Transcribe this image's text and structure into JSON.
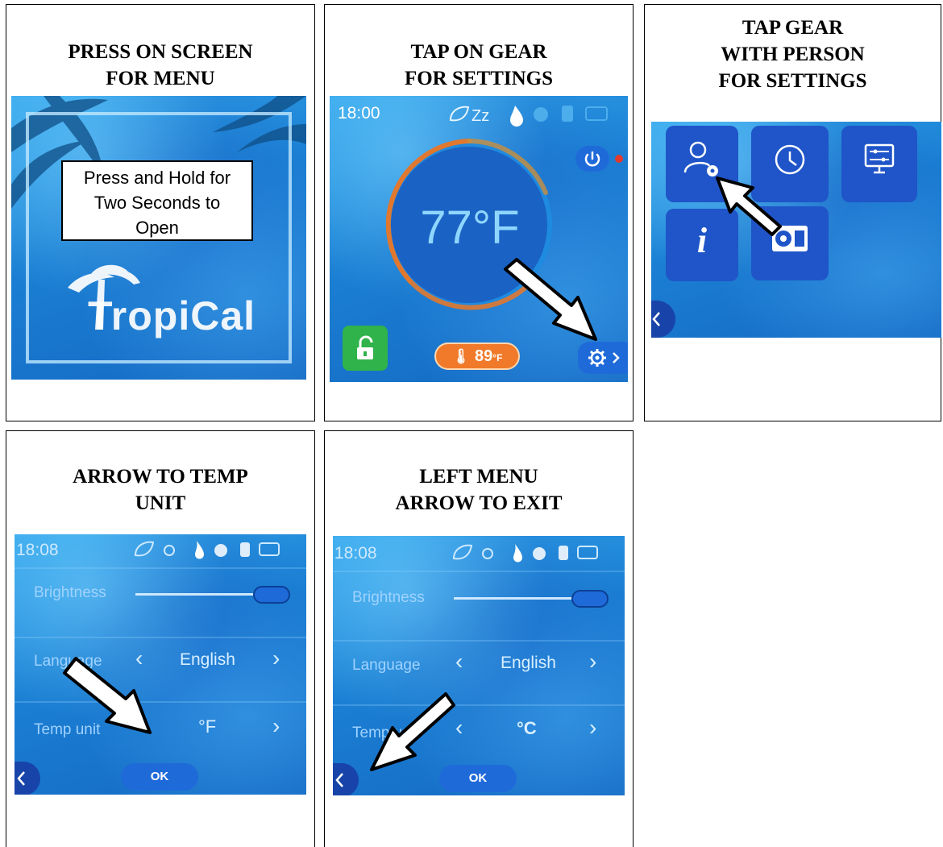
{
  "panels": [
    {
      "caption": [
        "PRESS ON SCREEN",
        "FOR MENU"
      ],
      "screen": {
        "callout_lines": [
          "Press and Hold for",
          "Two Seconds to",
          "Open"
        ],
        "logo": "TropiCal"
      }
    },
    {
      "caption": [
        "TAP ON GEAR",
        "FOR SETTINGS"
      ],
      "screen": {
        "time": "18:00",
        "temperature": "77°F",
        "water_temp": "89",
        "water_unit": "°F",
        "status_icons": [
          "eco-leaf-icon",
          "sleep-zz-icon",
          "water-drop-icon",
          "fan-icon",
          "heater-icon",
          "battery-icon"
        ]
      }
    },
    {
      "caption": [
        "TAP GEAR",
        "WITH PERSON",
        "FOR SETTINGS"
      ],
      "screen": {
        "tiles": [
          "user-settings-icon",
          "clock-icon",
          "display-settings-icon",
          "info-icon",
          "unit-icon"
        ],
        "info_glyph": "i"
      }
    },
    {
      "caption": [
        "ARROW TO TEMP",
        "UNIT"
      ],
      "screen": {
        "time": "18:08",
        "brightness_label": "Brightness",
        "language_label": "Language",
        "language_value": "English",
        "temp_unit_label": "Temp unit",
        "temp_unit_value": "°F",
        "ok_label": "OK"
      }
    },
    {
      "caption": [
        "LEFT MENU",
        "ARROW TO EXIT"
      ],
      "screen": {
        "time": "18:08",
        "brightness_label": "Brightness",
        "language_label": "Language",
        "language_value": "English",
        "temp_unit_label": "Temp unit",
        "temp_unit_value": "°C",
        "ok_label": "OK"
      }
    }
  ],
  "colors": {
    "screen_blue": "#1e84d6",
    "button_blue": "#1f6ad9",
    "lock_green": "#2fb34a",
    "badge_orange": "#f07a2a",
    "arc_orange": "#e0782f",
    "power_red": "#e23a2f"
  }
}
